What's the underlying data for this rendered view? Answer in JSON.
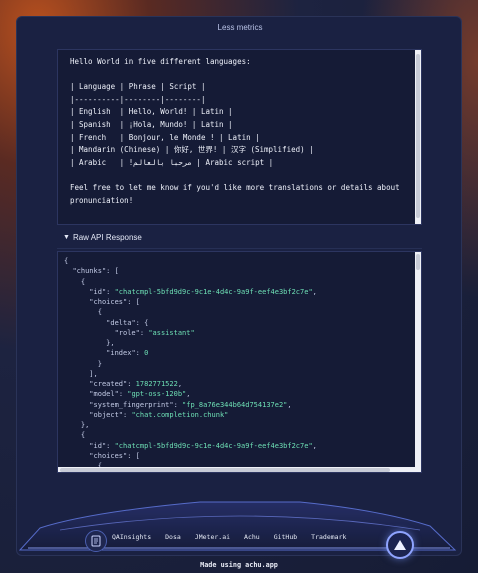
{
  "header": {
    "toggle_label": "Less metrics"
  },
  "message": {
    "lines": [
      "Hello World in five different languages:",
      "",
      "| Language | Phrase | Script |",
      "|----------|--------|--------|",
      "| English  | Hello, World! | Latin |",
      "| Spanish  | ¡Hola, Mundo! | Latin |",
      "| French   | Bonjour, le Monde ! | Latin |",
      "| Mandarin (Chinese) | 你好, 世界! | 汉字 (Simplified) |",
      "| Arabic   | !مرحبا بالعالم | Arabic script |",
      "",
      "Feel free to let me know if you'd like more translations or details about",
      "pronunciation!"
    ]
  },
  "raw": {
    "title": "Raw API Response",
    "triangle": "▼",
    "json_lines": [
      [
        [
          "p",
          "{"
        ]
      ],
      [
        [
          "p",
          "  "
        ],
        [
          "k",
          "\"chunks\""
        ],
        [
          "p",
          ": ["
        ]
      ],
      [
        [
          "p",
          "    {"
        ]
      ],
      [
        [
          "p",
          "      "
        ],
        [
          "k",
          "\"id\""
        ],
        [
          "p",
          ": "
        ],
        [
          "s",
          "\"chatcmpl-5bfd9d9c-9c1e-4d4c-9a9f-eef4e3bf2c7e\""
        ],
        [
          "p",
          ","
        ]
      ],
      [
        [
          "p",
          "      "
        ],
        [
          "k",
          "\"choices\""
        ],
        [
          "p",
          ": ["
        ]
      ],
      [
        [
          "p",
          "        {"
        ]
      ],
      [
        [
          "p",
          "          "
        ],
        [
          "k",
          "\"delta\""
        ],
        [
          "p",
          ": {"
        ]
      ],
      [
        [
          "p",
          "            "
        ],
        [
          "k",
          "\"role\""
        ],
        [
          "p",
          ": "
        ],
        [
          "s",
          "\"assistant\""
        ]
      ],
      [
        [
          "p",
          "          },"
        ]
      ],
      [
        [
          "p",
          "          "
        ],
        [
          "k",
          "\"index\""
        ],
        [
          "p",
          ": "
        ],
        [
          "n",
          "0"
        ]
      ],
      [
        [
          "p",
          "        }"
        ]
      ],
      [
        [
          "p",
          "      ],"
        ]
      ],
      [
        [
          "p",
          "      "
        ],
        [
          "k",
          "\"created\""
        ],
        [
          "p",
          ": "
        ],
        [
          "n",
          "1782771522"
        ],
        [
          "p",
          ","
        ]
      ],
      [
        [
          "p",
          "      "
        ],
        [
          "k",
          "\"model\""
        ],
        [
          "p",
          ": "
        ],
        [
          "s",
          "\"gpt-oss-120b\""
        ],
        [
          "p",
          ","
        ]
      ],
      [
        [
          "p",
          "      "
        ],
        [
          "k",
          "\"system_fingerprint\""
        ],
        [
          "p",
          ": "
        ],
        [
          "s",
          "\"fp_8a76e344b64d754137e2\""
        ],
        [
          "p",
          ","
        ]
      ],
      [
        [
          "p",
          "      "
        ],
        [
          "k",
          "\"object\""
        ],
        [
          "p",
          ": "
        ],
        [
          "s",
          "\"chat.completion.chunk\""
        ]
      ],
      [
        [
          "p",
          "    },"
        ]
      ],
      [
        [
          "p",
          "    {"
        ]
      ],
      [
        [
          "p",
          "      "
        ],
        [
          "k",
          "\"id\""
        ],
        [
          "p",
          ": "
        ],
        [
          "s",
          "\"chatcmpl-5bfd9d9c-9c1e-4d4c-9a9f-eef4e3bf2c7e\""
        ],
        [
          "p",
          ","
        ]
      ],
      [
        [
          "p",
          "      "
        ],
        [
          "k",
          "\"choices\""
        ],
        [
          "p",
          ": ["
        ]
      ],
      [
        [
          "p",
          "        {"
        ]
      ]
    ]
  },
  "footer": {
    "links": [
      "QAInsights",
      "Dosa",
      "JMeter.ai",
      "Achu",
      "GitHub",
      "Trademark"
    ],
    "made_using": "Made using achu.app",
    "icons": {
      "docs": "document-icon",
      "scroll_top": "arrow-up-icon"
    }
  },
  "colors": {
    "accent": "#8fa4ff",
    "json_value": "#6ee0b5",
    "panel": "#1a2142"
  }
}
